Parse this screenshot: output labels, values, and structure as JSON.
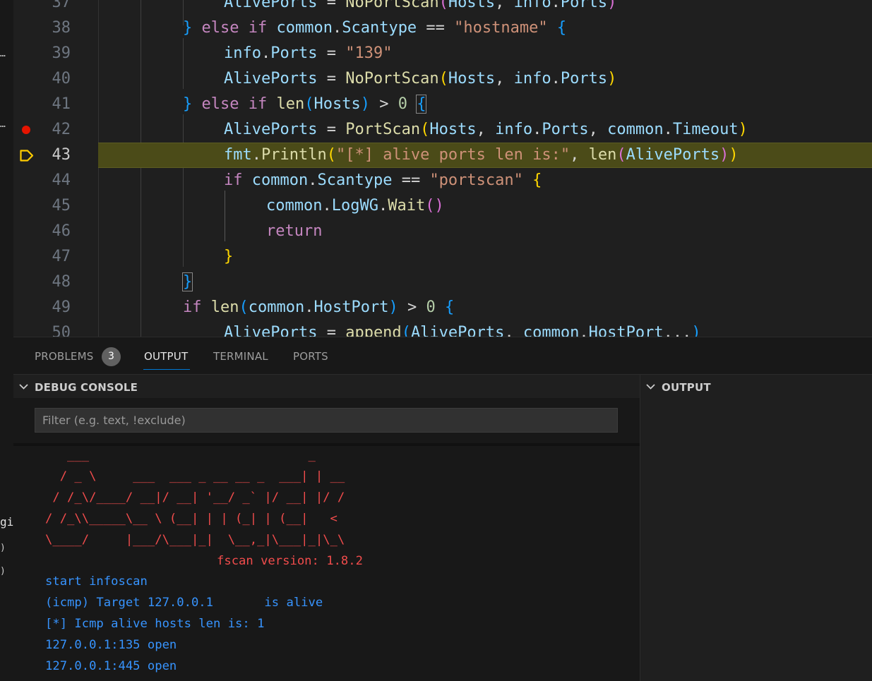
{
  "left_strip": {
    "fragments": [
      "…",
      "…",
      "gi",
      ")",
      ")"
    ]
  },
  "editor": {
    "lines": [
      {
        "no": "37",
        "text": "AlivePorts = NoPortScan(Hosts, info.Ports)"
      },
      {
        "no": "38",
        "text": "} else if common.Scantype == \"hostname\" {"
      },
      {
        "no": "39",
        "text": "info.Ports = \"139\""
      },
      {
        "no": "40",
        "text": "AlivePorts = NoPortScan(Hosts, info.Ports)"
      },
      {
        "no": "41",
        "text": "} else if len(Hosts) > 0 {"
      },
      {
        "no": "42",
        "text": "AlivePorts = PortScan(Hosts, info.Ports, common.Timeout)"
      },
      {
        "no": "43",
        "text": "fmt.Println(\"[*] alive ports len is:\", len(AlivePorts))"
      },
      {
        "no": "44",
        "text": "if common.Scantype == \"portscan\" {"
      },
      {
        "no": "45",
        "text": "common.LogWG.Wait()"
      },
      {
        "no": "46",
        "text": "return"
      },
      {
        "no": "47",
        "text": "}"
      },
      {
        "no": "48",
        "text": "}"
      },
      {
        "no": "49",
        "text": "if len(common.HostPort) > 0 {"
      },
      {
        "no": "50",
        "text": "AlivePorts = append(AlivePorts, common.HostPort...)"
      }
    ],
    "breakpoint_line": "42",
    "current_line": "43"
  },
  "panel": {
    "tabs": [
      {
        "label": "PROBLEMS",
        "badge": "3"
      },
      {
        "label": "OUTPUT"
      },
      {
        "label": "TERMINAL"
      },
      {
        "label": "PORTS"
      }
    ],
    "active_tab": "OUTPUT",
    "debug_console": {
      "title": "DEBUG CONSOLE",
      "filter_placeholder": "Filter (e.g. text, !exclude)",
      "banner": [
        "   ___                              _",
        "  / _ \\     ___  ___ _ __ __ _  ___| | __",
        " / /_\\/____/ __|/ __| '__/ _` |/ __| |/ /",
        "/ /_\\\\_____\\__ \\ (__| | | (_| | (__|   <",
        "\\____/     |___/\\___|_|  \\__,_|\\___|_|\\_\\"
      ],
      "version": "fscan version: 1.8.2",
      "logs": [
        "start infoscan",
        "(icmp) Target 127.0.0.1       is alive",
        "[*] Icmp alive hosts len is: 1",
        "127.0.0.1:135 open",
        "127.0.0.1:445 open"
      ]
    },
    "output_section": {
      "title": "OUTPUT"
    }
  },
  "colors": {
    "editor_bg": "#1f1f1f",
    "current_line_bg": "#4b4b18",
    "breakpoint": "#e51400",
    "console_banner": "#f14c4c",
    "console_log": "#3794ff",
    "tab_underline": "#0078d4"
  }
}
